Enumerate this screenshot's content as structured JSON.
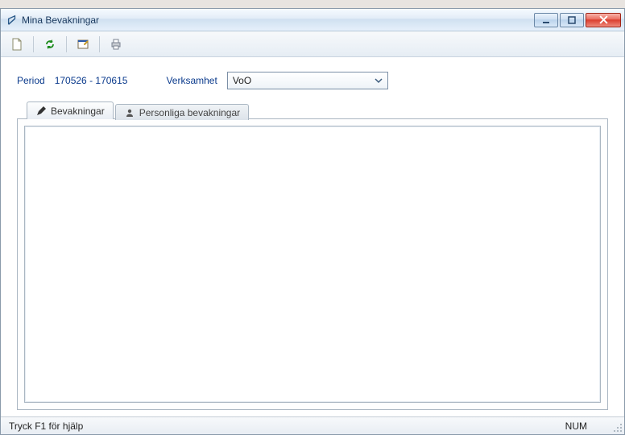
{
  "window": {
    "title": "Mina Bevakningar"
  },
  "toolbar": {
    "new_icon": "new-file-icon",
    "refresh_icon": "refresh-icon",
    "props_icon": "properties-icon",
    "print_icon": "print-icon"
  },
  "filters": {
    "period_label": "Period",
    "period_value": "170526 - 170615",
    "verksamhet_label": "Verksamhet",
    "verksamhet_value": "VoO"
  },
  "tabs": {
    "bevakningar": "Bevakningar",
    "personliga": "Personliga bevakningar"
  },
  "statusbar": {
    "help": "Tryck F1 för hjälp",
    "num": "NUM"
  }
}
